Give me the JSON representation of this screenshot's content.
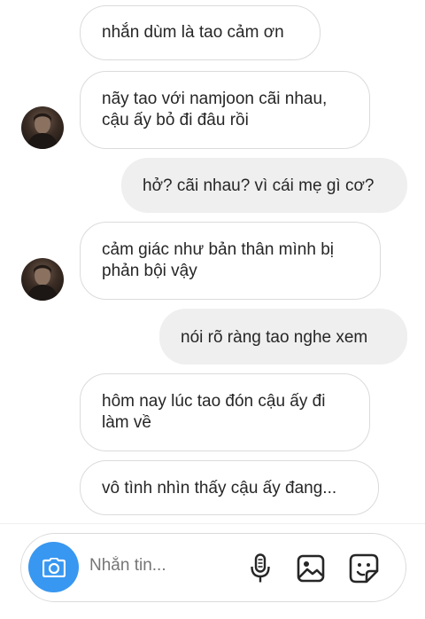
{
  "messages": [
    {
      "side": "incoming",
      "text": "nhắn dùm là tao cảm ơn"
    },
    {
      "side": "incoming",
      "text": "nãy tao với namjoon cãi nhau, cậu ấy bỏ đi đâu rồi"
    },
    {
      "side": "outgoing",
      "text": "hở? cãi nhau? vì cái mẹ gì cơ?"
    },
    {
      "side": "incoming",
      "text": "cảm giác như bản thân mình bị phản bội vậy"
    },
    {
      "side": "outgoing",
      "text": "nói rõ ràng tao nghe xem"
    },
    {
      "side": "incoming",
      "text": "hôm nay lúc tao đón cậu ấy đi làm về"
    },
    {
      "side": "incoming",
      "text": "vô tình nhìn thấy cậu ấy đang..."
    }
  ],
  "composer": {
    "placeholder": "Nhắn tin...",
    "icons": [
      "camera-icon",
      "microphone-icon",
      "gallery-icon",
      "sticker-icon"
    ]
  },
  "colors": {
    "accent": "#3897f0",
    "outgoing_bubble": "#efefef",
    "bubble_border": "#dbdbdb",
    "placeholder": "#8e8e8e"
  }
}
